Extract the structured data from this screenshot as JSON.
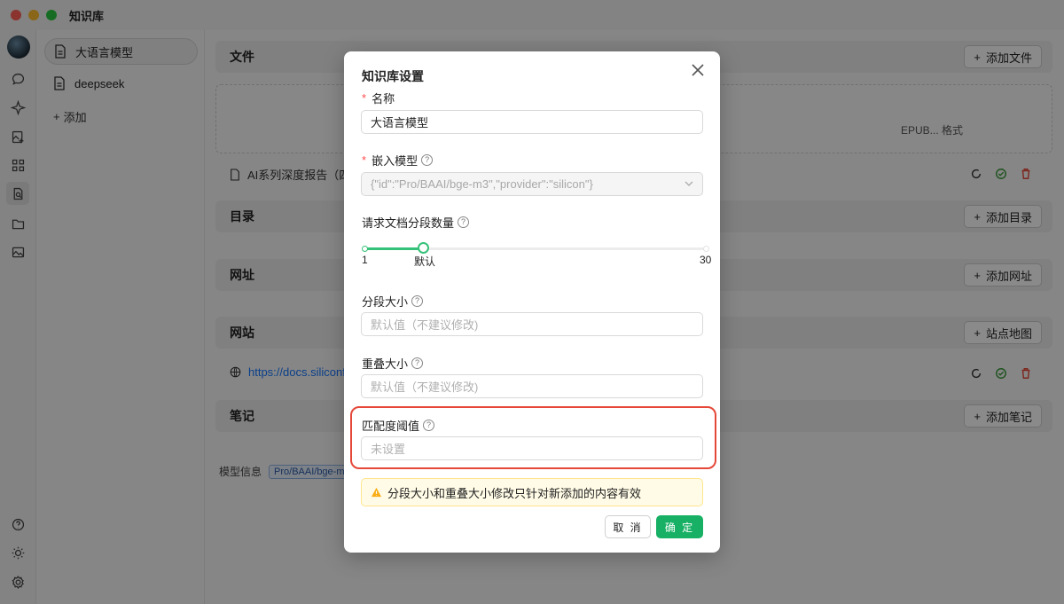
{
  "window": {
    "title": "知识库"
  },
  "colors": {
    "accent": "#17b064",
    "slider": "#35c178",
    "highlight": "#e54839",
    "warning_bg": "#fffbe6",
    "link": "#1677ff"
  },
  "rail_icons": [
    "avatar",
    "chat-icon",
    "sparkle-icon",
    "image-edit-icon",
    "apps-grid-icon",
    "knowledge-base-icon",
    "folder-icon",
    "image-icon",
    "help-icon",
    "theme-icon",
    "settings-icon"
  ],
  "knowledge_list": {
    "items": [
      {
        "label": "大语言模型",
        "selected": true
      },
      {
        "label": "deepseek",
        "selected": false
      }
    ],
    "add_label": "添加"
  },
  "main": {
    "files": {
      "title": "文件",
      "button": "添加文件",
      "drop_hint": "EPUB... 格式",
      "row": "AI系列深度报告（四）"
    },
    "directory": {
      "title": "目录",
      "button": "添加目录"
    },
    "url": {
      "title": "网址",
      "button": "添加网址"
    },
    "website": {
      "title": "网站",
      "button": "站点地图",
      "row": "https://docs.siliconflo"
    },
    "notes": {
      "title": "笔记",
      "button": "添加笔记"
    },
    "model_info": {
      "label": "模型信息",
      "tag": "Pro/BAAI/bge-m3"
    }
  },
  "dialog": {
    "title": "知识库设置",
    "name": {
      "label": "名称",
      "value": "大语言模型"
    },
    "embed_model": {
      "label": "嵌入模型",
      "value": "{\"id\":\"Pro/BAAI/bge-m3\",\"provider\":\"silicon\"}"
    },
    "doc_count": {
      "label": "请求文档分段数量",
      "min": 1,
      "max": 30,
      "value": 6,
      "min_label": "1",
      "default_label": "默认",
      "max_label": "30"
    },
    "chunk_size": {
      "label": "分段大小",
      "placeholder": "默认值（不建议修改)"
    },
    "chunk_overlap": {
      "label": "重叠大小",
      "placeholder": "默认值（不建议修改)"
    },
    "threshold": {
      "label": "匹配度阈值",
      "placeholder": "未设置"
    },
    "warning": "分段大小和重叠大小修改只针对新添加的内容有效",
    "cancel_label": "取 消",
    "ok_label": "确 定"
  }
}
